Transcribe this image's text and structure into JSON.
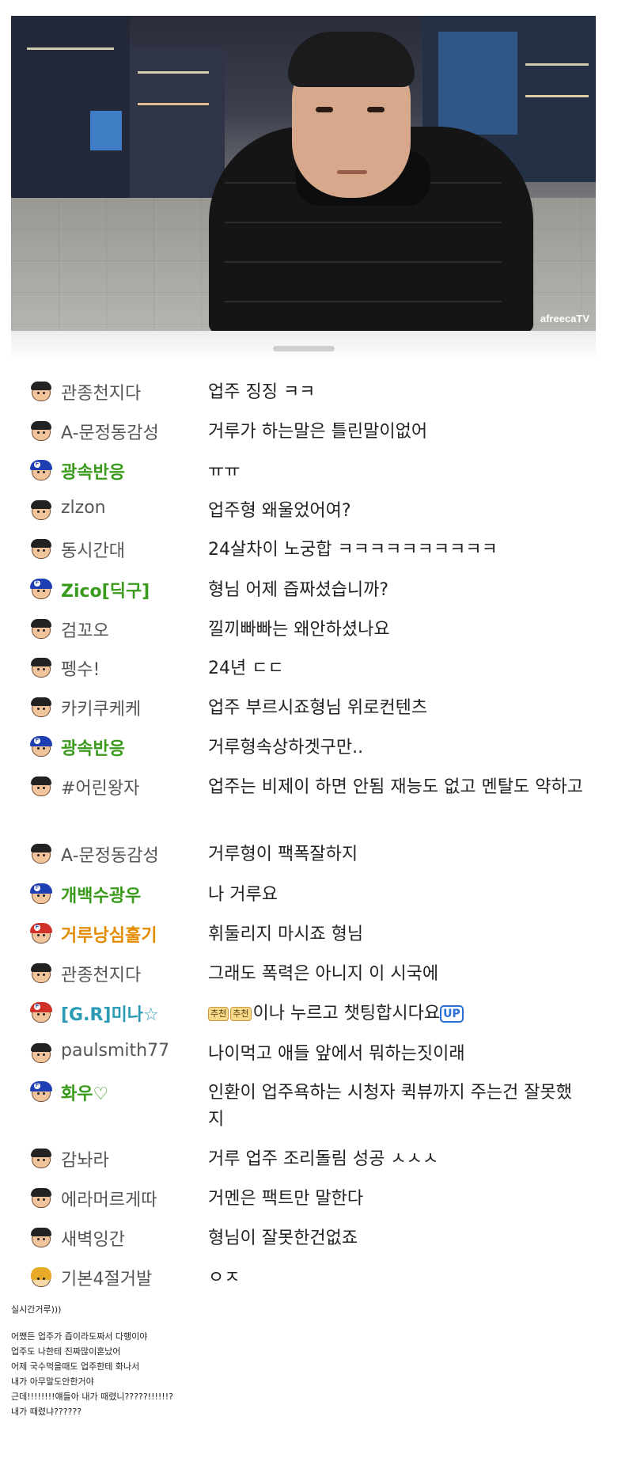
{
  "video": {
    "watermark": "afreecaTV"
  },
  "chat": [
    {
      "nick": "관종천지다",
      "msg": "업주 징징 ㅋㅋ",
      "style": "normal",
      "avatar": "user-avatar-icon"
    },
    {
      "nick": "A-문정동감성",
      "msg": "거루가 하는말은 틀린말이없어",
      "style": "normal",
      "avatar": "user-avatar-icon"
    },
    {
      "nick": "광속반응",
      "msg": "ㅠㅠ",
      "style": "green",
      "avatar": "fan-avatar-icon"
    },
    {
      "nick": "zlzon",
      "msg": "업주형 왜울었어여?",
      "style": "normal",
      "avatar": "user-avatar-icon"
    },
    {
      "nick": "동시간대",
      "msg": "24살차이 노궁합 ㅋㅋㅋㅋㅋㅋㅋㅋㅋㅋ",
      "style": "normal",
      "avatar": "user-avatar-icon"
    },
    {
      "nick": "Zico[딕구]",
      "msg": "형님 어제 즙짜셨습니까?",
      "style": "green",
      "avatar": "fan-avatar-icon"
    },
    {
      "nick": "검꼬오",
      "msg": "낄끼빠빠는 왜안하셨나요",
      "style": "normal",
      "avatar": "user-avatar-icon"
    },
    {
      "nick": "펭수!",
      "msg": "24년 ㄷㄷ",
      "style": "normal",
      "avatar": "user-avatar-icon"
    },
    {
      "nick": "카키쿠케케",
      "msg": "업주 부르시죠형님 위로컨텐츠",
      "style": "normal",
      "avatar": "user-avatar-icon"
    },
    {
      "nick": "광속반응",
      "msg": "거루형속상하겟구만..",
      "style": "green",
      "avatar": "fan-avatar-icon"
    },
    {
      "nick": "#어린왕자",
      "msg": "업주는 비제이 하면 안됨 재능도 없고 멘탈도 약하고",
      "style": "normal",
      "avatar": "user-avatar-icon"
    },
    {
      "nick": "A-문정동감성",
      "msg": "거루형이 팩폭잘하지",
      "style": "normal",
      "avatar": "user-avatar-icon"
    },
    {
      "nick": "개백수광우",
      "msg": "나 거루요",
      "style": "green",
      "avatar": "fan-avatar-icon"
    },
    {
      "nick": "거루낭심훌기",
      "msg": "휘둘리지 마시죠 형님",
      "style": "orange",
      "avatar": "manager-avatar-icon"
    },
    {
      "nick": "관종천지다",
      "msg": "그래도 폭력은 아니지 이 시국에",
      "style": "normal",
      "avatar": "user-avatar-icon"
    },
    {
      "nick": "[G.R]미나☆",
      "msg": "이나 누르고 챗팅합시다요",
      "style": "teal",
      "avatar": "vip-avatar-icon",
      "badge1": "추천",
      "badge2": "추천",
      "up": "UP"
    },
    {
      "nick": "paulsmith77",
      "msg": "나이먹고 애들 앞에서 뭐하는짓이래",
      "style": "normal",
      "avatar": "user-avatar-icon"
    },
    {
      "nick": "화우♡",
      "msg": "인환이 업주욕하는 시청자 퀵뷰까지 주는건 잘못했지",
      "style": "green",
      "avatar": "fan-avatar-icon"
    },
    {
      "nick": "감놔라",
      "msg": "거루 업주 조리돌림 성공 ㅅㅅㅅ",
      "style": "normal",
      "avatar": "user-avatar-icon"
    },
    {
      "nick": "에라머르게따",
      "msg": "거멘은 팩트만 말한다",
      "style": "normal",
      "avatar": "user-avatar-icon"
    },
    {
      "nick": "새벽잉간",
      "msg": "형님이 잘못한건없죠",
      "style": "normal",
      "avatar": "user-avatar-icon"
    },
    {
      "nick": "기본4절거발",
      "msg": "ㅇㅈ",
      "style": "normal",
      "avatar": "girl-avatar-icon"
    }
  ],
  "caption": {
    "line1": "실시간거루)))",
    "line2": "어쨌든 업주가 즙이라도짜서 다행이야",
    "line3": "업주도 나한테 진짜많이혼났어",
    "line4": "어제 국수먹을때도 업주한테 화나서",
    "line5": "내가 아무말도안한거야",
    "line6": "근데!!!!!!!!얘들아  내가 때렸니?????!!!!!!?",
    "line7": "내가 때렸냐??????"
  }
}
